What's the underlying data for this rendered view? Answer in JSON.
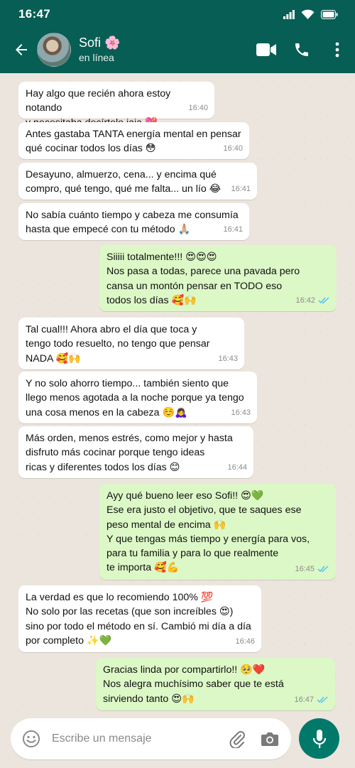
{
  "status_bar": {
    "time": "16:47"
  },
  "contact": {
    "name": "Sofi 🌸",
    "status": "en línea"
  },
  "colors": {
    "header": "#075e54",
    "incoming": "#ffffff",
    "outgoing": "#dcf8c6",
    "read_ticks": "#4fc3f7",
    "mic_button": "#00796b"
  },
  "messages": [
    {
      "dir": "in",
      "text": "Hay algo que recién ahora estoy notando\ny necesitaba decírtelo jaja 💖",
      "time": "16:40"
    },
    {
      "dir": "in",
      "text": "Antes gastaba TANTA energía mental en pensar\nqué cocinar todos los días 😳",
      "time": "16:40"
    },
    {
      "dir": "in",
      "text": "Desayuno, almuerzo, cena... y encima qué\ncompro, qué tengo, qué me falta... un lío 😂",
      "time": "16:41"
    },
    {
      "dir": "in",
      "text": "No sabía cuánto tiempo y cabeza me consumía\nhasta que empecé con tu método 🙏🏼",
      "time": "16:41"
    },
    {
      "dir": "out",
      "text": "Siiiii totalmente!!! 😍😍😍\nNos pasa a todas, parece una pavada pero\ncansa un montón pensar en TODO eso\ntodos los días 🥰🙌",
      "time": "16:42",
      "read": true
    },
    {
      "dir": "in",
      "text": "Tal cual!!! Ahora abro el día que toca y\ntengo todo resuelto, no tengo que pensar\nNADA 🥰🙌",
      "time": "16:43"
    },
    {
      "dir": "in",
      "text": "Y no solo ahorro tiempo... también siento que\nllego menos agotada a la noche porque ya tengo\nuna cosa menos en la cabeza ☺️🙇‍♀️",
      "time": "16:43"
    },
    {
      "dir": "in",
      "text": "Más orden, menos estrés, como mejor y hasta\ndisfruto más cocinar porque tengo ideas\nricas y diferentes todos los días 😊",
      "time": "16:44"
    },
    {
      "dir": "out",
      "text": "Ayy qué bueno leer eso Sofi!! 😍💚\nEse era justo el objetivo, que te saques ese\npeso mental de encima 🙌\nY que tengas más tiempo y energía para vos,\npara tu familia y para lo que realmente\nte importa 🥰💪",
      "time": "16:45",
      "read": true
    },
    {
      "dir": "in",
      "text": "La verdad es que lo recomiendo 100% 💯\nNo solo por las recetas (que son increíbles 😍)\nsino por todo el método en sí. Cambió mi día a día\npor completo ✨💚",
      "time": "16:46"
    },
    {
      "dir": "out",
      "text": "Gracias linda por compartirlo!! 🥺❤️\nNos alegra muchísimo saber que te está\nsirviendo tanto 😍🙌",
      "time": "16:47",
      "read": true
    }
  ],
  "composer": {
    "placeholder": "Escribe un mensaje"
  },
  "icons": {
    "back": "arrow-left-icon",
    "video": "video-call-icon",
    "call": "phone-icon",
    "menu": "more-vert-icon",
    "emoji": "emoji-icon",
    "attach": "paperclip-icon",
    "camera": "camera-icon",
    "mic": "microphone-icon"
  }
}
